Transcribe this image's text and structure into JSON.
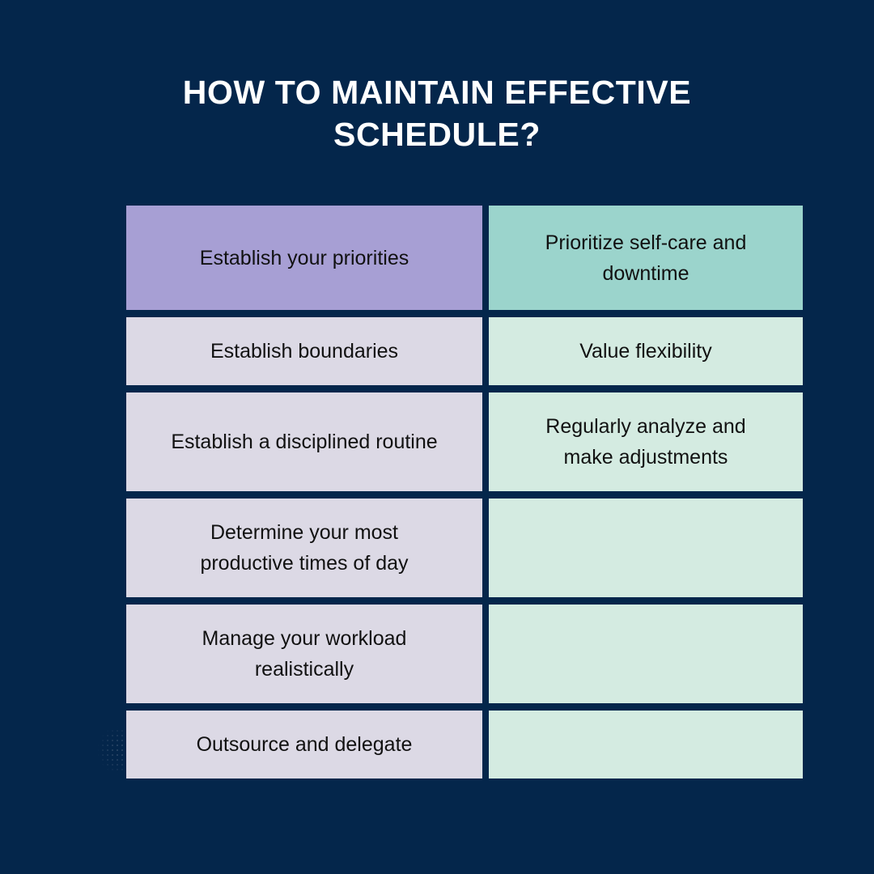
{
  "page": {
    "background_color": "#04264B",
    "title": "How to Maintain Effective\nSchedule?"
  },
  "colors": {
    "background_navy": "#04264B",
    "header_left_purple": "#A79FD4",
    "header_right_teal": "#9BD4CC",
    "body_left_lavender": "#DCD9E5",
    "body_right_mint": "#D4EBE1",
    "title_text": "#FFFFFF",
    "cell_text": "#111111"
  },
  "table": {
    "columns": 2,
    "rows": 6,
    "headers": {
      "left": "Establish your priorities",
      "right": "Prioritize self-care and\ndowntime"
    },
    "body_rows": [
      {
        "left": "Establish boundaries",
        "right": "Value flexibility"
      },
      {
        "left": "Establish a disciplined routine",
        "right": "Regularly analyze and\nmake adjustments"
      },
      {
        "left": "Determine your most\nproductive times of day",
        "right": ""
      },
      {
        "left": "Manage your workload\nrealistically",
        "right": ""
      },
      {
        "left": "Outsource and delegate",
        "right": ""
      }
    ]
  }
}
